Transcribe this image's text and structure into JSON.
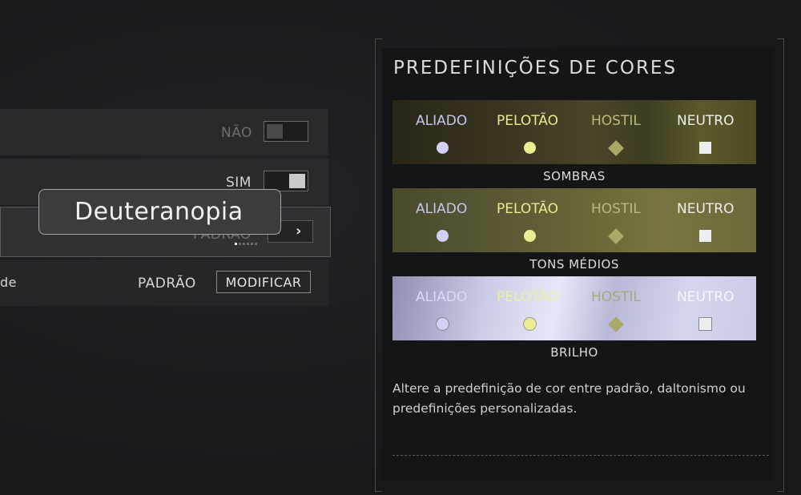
{
  "settings": {
    "row1_value": "NÃO",
    "row2_value": "SIM",
    "row3_value": "PADRÃO",
    "row4_fragment": "de",
    "row4_value": "PADRÃO",
    "row4_button": "MODIFICAR"
  },
  "selector": {
    "left_arrow": "‹",
    "right_arrow": "›",
    "page_indicator": {
      "active": 1,
      "total": 6
    }
  },
  "tooltip": {
    "text": "Deuteranopia"
  },
  "panel": {
    "title": "PREDEFINIÇÕES DE CORES",
    "swatches": [
      {
        "label": "SOMBRAS",
        "ally": "ALIADO",
        "platoon": "PELOTÃO",
        "hostile": "HOSTIL",
        "neutral": "NEUTRO"
      },
      {
        "label": "TONS MÉDIOS",
        "ally": "ALIADO",
        "platoon": "PELOTÃO",
        "hostile": "HOSTIL",
        "neutral": "NEUTRO"
      },
      {
        "label": "BRILHO",
        "ally": "ALIADO",
        "platoon": "PELOTÃO",
        "hostile": "HOSTIL",
        "neutral": "NEUTRO"
      }
    ],
    "description": "Altere a predefinição de cor entre padrão, daltonismo ou predefinições personalizadas."
  },
  "icons": [
    "toggle-off-icon",
    "toggle-on-icon",
    "chevron-left-icon",
    "chevron-right-icon",
    "circle-icon",
    "diamond-icon",
    "square-icon"
  ],
  "colors": {
    "ally": "#d0d1f4",
    "platoon": "#ecec92",
    "hostile": "#a9aa66",
    "neutral": "#eeeeee"
  }
}
